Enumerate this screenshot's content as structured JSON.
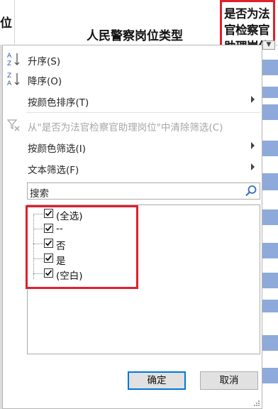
{
  "sheet_header": {
    "col_left_partial": "位",
    "col_mid": "人民警察岗位类型",
    "col_right_lines": [
      "是否为法",
      "官检察官",
      "助理岗位"
    ]
  },
  "filter_button_glyph": "▼",
  "menu": {
    "sort_asc": "升序(S)",
    "sort_desc": "降序(O)",
    "sort_by_color": "按颜色排序(T)",
    "clear_filter": "从\"是否为法官检察官助理岗位\"中清除筛选(C)",
    "filter_by_color": "按颜色筛选(I)",
    "text_filter": "文本筛选(F)"
  },
  "search": {
    "placeholder": "搜索"
  },
  "filter_items": [
    {
      "label": "(全选)",
      "checked": true
    },
    {
      "label": "--",
      "checked": true
    },
    {
      "label": "否",
      "checked": true
    },
    {
      "label": "是",
      "checked": true
    },
    {
      "label": "(空白)",
      "checked": true
    }
  ],
  "buttons": {
    "ok": "确定",
    "cancel": "取消"
  },
  "colors": {
    "highlight_red": "#e0202a",
    "accent_blue": "#0078d7",
    "stripe_blue": "#8eaadb"
  }
}
